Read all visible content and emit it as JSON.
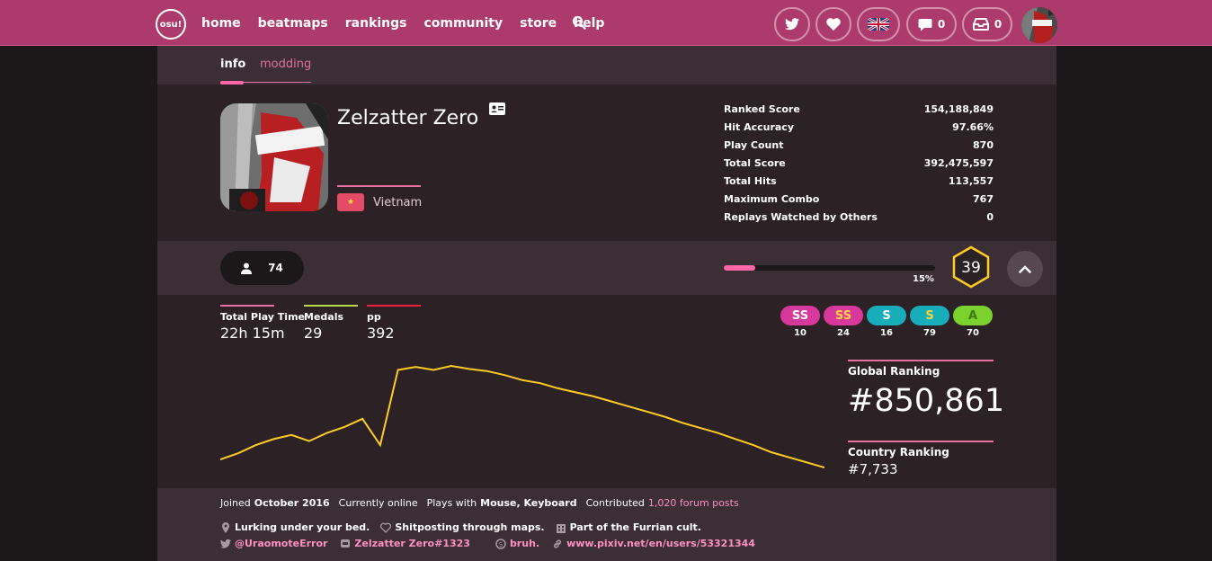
{
  "nav": {
    "logo": "osu!",
    "links": [
      "home",
      "beatmaps",
      "rankings",
      "community",
      "store",
      "help"
    ],
    "messages_count": "0",
    "notifications_count": "0"
  },
  "tabs": [
    "info",
    "modding"
  ],
  "profile": {
    "username": "Zelzatter Zero",
    "country": "Vietnam",
    "followers": "74",
    "level": "39",
    "level_progress": 15,
    "level_progress_label": "15%"
  },
  "stats": [
    {
      "label": "Ranked Score",
      "value": "154,188,849"
    },
    {
      "label": "Hit Accuracy",
      "value": "97.66%"
    },
    {
      "label": "Play Count",
      "value": "870"
    },
    {
      "label": "Total Score",
      "value": "392,475,597"
    },
    {
      "label": "Total Hits",
      "value": "113,557"
    },
    {
      "label": "Maximum Combo",
      "value": "767"
    },
    {
      "label": "Replays Watched by Others",
      "value": "0"
    }
  ],
  "mini_stats": [
    {
      "label": "Total Play Time",
      "value": "22h 15m",
      "color": "#e671a0"
    },
    {
      "label": "Medals",
      "value": "29",
      "color": "#b3d944"
    },
    {
      "label": "pp",
      "value": "392",
      "color": "#ed1c39"
    }
  ],
  "grade_counts": [
    {
      "grade": "SS",
      "count": "10",
      "bg": "#d6389b",
      "fg": "#ffffff"
    },
    {
      "grade": "SS",
      "count": "24",
      "bg": "#d6389b",
      "fg": "#ffd23a"
    },
    {
      "grade": "S",
      "count": "16",
      "bg": "#18aeb9",
      "fg": "#ffffff"
    },
    {
      "grade": "S",
      "count": "79",
      "bg": "#18aeb9",
      "fg": "#ffd23a"
    },
    {
      "grade": "A",
      "count": "70",
      "bg": "#7bd12e",
      "fg": "#3f7a10"
    }
  ],
  "rankings": {
    "global_label": "Global Ranking",
    "global_value": "#850,861",
    "country_label": "Country Ranking",
    "country_value": "#7,733"
  },
  "footer": {
    "joined_prefix": "Joined",
    "joined": "October 2016",
    "status": "Currently online",
    "plays_with_prefix": "Plays with",
    "plays_with": "Mouse, Keyboard",
    "contributed_prefix": "Contributed",
    "forum_posts": "1,020 forum posts",
    "location": "Lurking under your bed.",
    "interests": "Shitposting through maps.",
    "occupation": "Part of the Furrian cult.",
    "twitter": "@UraomoteError",
    "discord": "Zelzatter Zero#1323",
    "skype": "bruh.",
    "website": "www.pixiv.net/en/users/53321344"
  },
  "chart_data": {
    "type": "line",
    "title": "",
    "xlabel": "",
    "ylabel": "",
    "series": [
      {
        "values": [
          0.08,
          0.14,
          0.22,
          0.28,
          0.32,
          0.26,
          0.34,
          0.4,
          0.48,
          0.22,
          0.96,
          0.99,
          0.96,
          1.0,
          0.97,
          0.95,
          0.91,
          0.86,
          0.83,
          0.78,
          0.74,
          0.7,
          0.65,
          0.6,
          0.55,
          0.5,
          0.44,
          0.39,
          0.34,
          0.28,
          0.22,
          0.15,
          0.1,
          0.05,
          0.0
        ]
      }
    ],
    "color": "#ffcc22"
  }
}
